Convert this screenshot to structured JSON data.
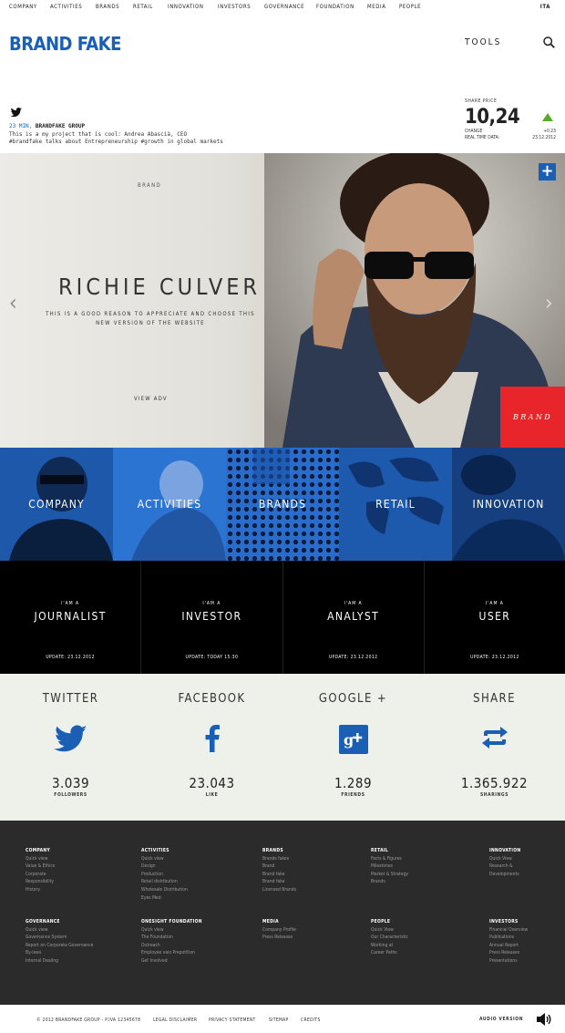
{
  "topnav": {
    "items": [
      "COMPANY",
      "ACTIVITIES",
      "BRANDS",
      "RETAIL",
      "INNOVATION",
      "INVESTORS",
      "GOVERNANCE",
      "FOUNDATION",
      "MEDIA",
      "PEOPLE"
    ],
    "lang": "ITA"
  },
  "header": {
    "logo": "BRAND FAKE",
    "tools": "TOOLS"
  },
  "tweet": {
    "time": "23 MIN,",
    "author": "BRANDFAKE GROUP",
    "line1": "This is a my project that is cool: Andrea Abascià, CEO",
    "line2": "#brandfake talks about Entrepreneurship #growth in global markets"
  },
  "share_price": {
    "label": "SHARE PRICE",
    "value": "10,24",
    "change_label": "CHANGE",
    "change_value": "+0.23",
    "rt_label": "REAL TIME DATA:",
    "rt_value": "23.12.2012"
  },
  "hero": {
    "tag": "BRAND",
    "name": "RICHIE CULVER",
    "sub": "THIS IS A GOOD REASON TO APPRECIATE AND CHOOSE THIS NEW VERSION OF THE WEBSITE",
    "view": "VIEW ADV",
    "brand_box": "BRAND",
    "plus": "+",
    "arrow_left": "‹",
    "arrow_right": "›"
  },
  "tiles": [
    "COMPANY",
    "ACTIVITIES",
    "BRANDS",
    "RETAIL",
    "INNOVATION"
  ],
  "roles": [
    {
      "small": "I'AM A",
      "big": "JOURNALIST",
      "upd": "UPDATE: 23.12.2012"
    },
    {
      "small": "I'AM A",
      "big": "INVESTOR",
      "upd": "UPDATE: TODAY 15:30"
    },
    {
      "small": "I'AM A",
      "big": "ANALYST",
      "upd": "UPDATE: 23.12.2012"
    },
    {
      "small": "I'AM A",
      "big": "USER",
      "upd": "UPDATE: 23.12.2012"
    }
  ],
  "social": [
    {
      "title": "TWITTER",
      "num": "3.039",
      "cap": "FOLLOWERS",
      "icon": "twitter-bird-icon"
    },
    {
      "title": "FACEBOOK",
      "num": "23.043",
      "cap": "LIKE",
      "icon": "facebook-icon"
    },
    {
      "title": "GOOGLE +",
      "num": "1.289",
      "cap": "FRIENDS",
      "icon": "google-plus-icon"
    },
    {
      "title": "SHARE",
      "num": "1.365.922",
      "cap": "SHARINGS",
      "icon": "share-arrows-icon"
    }
  ],
  "footer": {
    "company": {
      "h": "COMPANY",
      "items": [
        "Quick view",
        "Value & Ethics",
        "Corporate",
        "Responsibility",
        "History"
      ]
    },
    "activities": {
      "h": "ACTIVITIES",
      "items": [
        "Quick view",
        "Design",
        "Production",
        "Retail distribution",
        "Wholesale Distribution",
        "Eyes Med"
      ]
    },
    "brands": {
      "h": "BRANDS",
      "items": [
        "Brands fakes",
        "Brand",
        "Brand fake",
        "Brand fake",
        "Licensed Brands"
      ]
    },
    "retail": {
      "h": "RETAIL",
      "items": [
        "Facts & Figures",
        "Milestones",
        "Market & Strategy",
        "Brands"
      ]
    },
    "innovation": {
      "h": "INNOVATION",
      "items": [
        "Quick View",
        "Research &",
        "Developments"
      ]
    },
    "governance": {
      "h": "GOVERNANCE",
      "items": [
        "Quick view",
        "Governance System",
        "Report on Corporate Governance",
        "By-laws",
        "Internal Dealing"
      ]
    },
    "foundation": {
      "h": "ONESIGHT FOUNDATION",
      "items": [
        "Quick view",
        "The Foundation",
        "Outreach",
        "Employee vaio Prepotition",
        "Get Involved"
      ]
    },
    "media": {
      "h": "MEDIA",
      "items": [
        "Company Profile",
        "Press Releases"
      ]
    },
    "people": {
      "h": "PEOPLE",
      "items": [
        "Quick View",
        "Our Characteristic",
        "Working at",
        "Career Paths"
      ]
    },
    "investors": {
      "h": "INVESTORS",
      "items": [
        "Financial Overview",
        "Publications",
        "Annual Report",
        "Press Releases",
        "Presentations"
      ]
    }
  },
  "bottom": {
    "copyright": "© 2012 BRANDFAKE GROUP - P.IVA 12345678",
    "legal": "LEGAL DISCLAIMER",
    "privacy": "PRIVACY STATEMENT",
    "sitemap": "SITEMAP",
    "credits": "CREDITS",
    "audio": "AUDIO VERSION"
  },
  "colors": {
    "accent": "#1a5fb4",
    "red": "#e8252a",
    "up": "#5aaa2a",
    "footer": "#2b2b2b",
    "social_bg": "#eef0ea"
  }
}
